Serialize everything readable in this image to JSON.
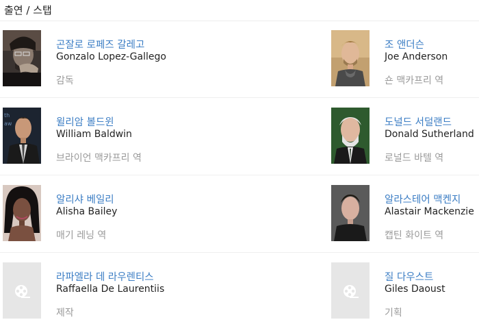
{
  "section": {
    "title": "출연 / 스탭"
  },
  "cast": [
    {
      "name_ko": "곤잘로 로페즈 갈레고",
      "name_en": "Gonzalo Lopez-Gallego",
      "role": "감독",
      "photo": "portrait-photo"
    },
    {
      "name_ko": "조 앤더슨",
      "name_en": "Joe Anderson",
      "role": "숀 맥카프리 역",
      "photo": "portrait-photo"
    },
    {
      "name_ko": "윌리암 볼드윈",
      "name_en": "William Baldwin",
      "role": "브라이언 맥카프리 역",
      "photo": "portrait-photo"
    },
    {
      "name_ko": "도널드 서덜랜드",
      "name_en": "Donald Sutherland",
      "role": "로널드 바텔 역",
      "photo": "portrait-photo"
    },
    {
      "name_ko": "알리샤 베일리",
      "name_en": "Alisha Bailey",
      "role": "매기 레닝 역",
      "photo": "portrait-photo"
    },
    {
      "name_ko": "알라스테어 맥켄지",
      "name_en": "Alastair Mackenzie",
      "role": "캡틴 화이트 역",
      "photo": "portrait-photo"
    },
    {
      "name_ko": "라파엘라 데 라우렌티스",
      "name_en": "Raffaella De Laurentiis",
      "role": "제작",
      "photo": "film-reel-placeholder-icon"
    },
    {
      "name_ko": "질 다우스트",
      "name_en": "Giles Daoust",
      "role": "기획",
      "photo": "film-reel-placeholder-icon"
    }
  ]
}
